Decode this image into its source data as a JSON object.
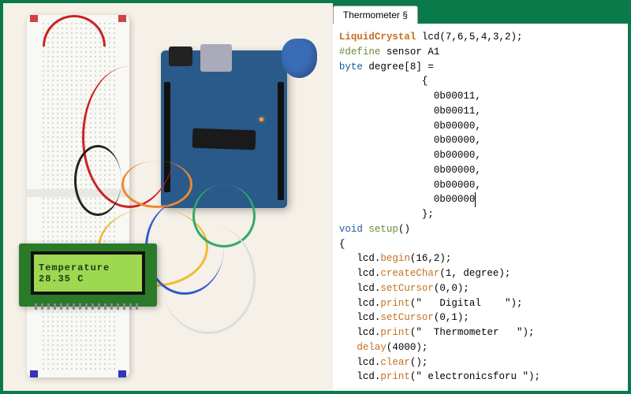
{
  "tab": {
    "title": "Thermometer §"
  },
  "lcd_display": {
    "line1": "Temperature",
    "line2": "28.35 C"
  },
  "hardware": {
    "board": "Arduino UNO",
    "display": "16x2 LCD",
    "sensor_pin": "A1"
  },
  "code": {
    "l1_a": "LiquidCrystal",
    "l1_b": " lcd(7,6,5,4,3,2);",
    "l2_a": "#define",
    "l2_b": " sensor A1",
    "l3_a": "byte",
    "l3_b": " degree[8] =",
    "l4": "              {",
    "l5": "                0b00011,",
    "l6": "                0b00011,",
    "l7": "                0b00000,",
    "l8": "                0b00000,",
    "l9": "                0b00000,",
    "l10": "                0b00000,",
    "l11": "                0b00000,",
    "l12": "                0b00000",
    "l13": "              };",
    "l14_a": "void",
    "l14_b": " ",
    "l14_c": "setup",
    "l14_d": "()",
    "l15": "{",
    "l16_a": "   lcd.",
    "l16_b": "begin",
    "l16_c": "(16,2);",
    "l17_a": "   lcd.",
    "l17_b": "createChar",
    "l17_c": "(1, degree);",
    "l18_a": "   lcd.",
    "l18_b": "setCursor",
    "l18_c": "(0,0);",
    "l19_a": "   lcd.",
    "l19_b": "print",
    "l19_c": "(\"   Digital    \");",
    "l20_a": "   lcd.",
    "l20_b": "setCursor",
    "l20_c": "(0,1);",
    "l21_a": "   lcd.",
    "l21_b": "print",
    "l21_c": "(\"  Thermometer   \");",
    "l22_a": "   ",
    "l22_b": "delay",
    "l22_c": "(4000);",
    "l23_a": "   lcd.",
    "l23_b": "clear",
    "l23_c": "();",
    "l24_a": "   lcd.",
    "l24_b": "print",
    "l24_c": "(\" electronicsforu \");"
  }
}
